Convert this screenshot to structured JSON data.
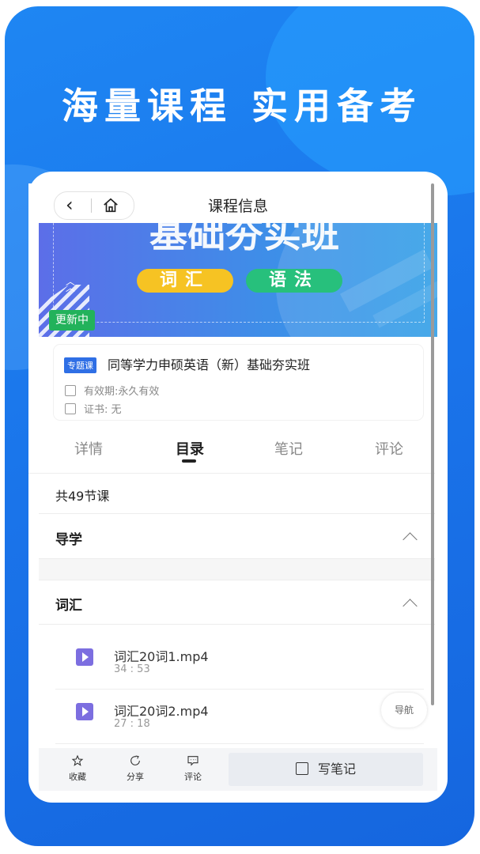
{
  "promo": {
    "headline": "海量课程 实用备考"
  },
  "header": {
    "title": "课程信息",
    "back_icon": "chevron-left-icon",
    "home_icon": "home-icon"
  },
  "banner": {
    "title": "基础夯实班",
    "tag_vocab": "词汇",
    "tag_grammar": "语法",
    "status_badge": "更新中"
  },
  "course": {
    "type_tag": "专题课",
    "title": "同等学力申硕英语（新）基础夯实班",
    "validity": "有效期:永久有效",
    "certificate": "证书: 无"
  },
  "tabs": [
    {
      "label": "详情"
    },
    {
      "label": "目录"
    },
    {
      "label": "笔记"
    },
    {
      "label": "评论"
    }
  ],
  "active_tab": "目录",
  "catalog": {
    "total": "共49节课",
    "sections": [
      {
        "title": "导学"
      },
      {
        "title": "词汇",
        "lessons": [
          {
            "name": "词汇20词1.mp4",
            "duration": "34 : 53"
          },
          {
            "name": "词汇20词2.mp4",
            "duration": "27 : 18"
          }
        ]
      }
    ]
  },
  "nav_fab": "导航",
  "bottom_bar": {
    "favorite": "收藏",
    "share": "分享",
    "comment": "评论",
    "write_note": "写笔记"
  },
  "colors": {
    "brand_blue": "#1a74ea",
    "tag_blue": "#2f6fe5",
    "badge_green": "#22b25b",
    "lesson_purple": "#7c6ee0"
  }
}
